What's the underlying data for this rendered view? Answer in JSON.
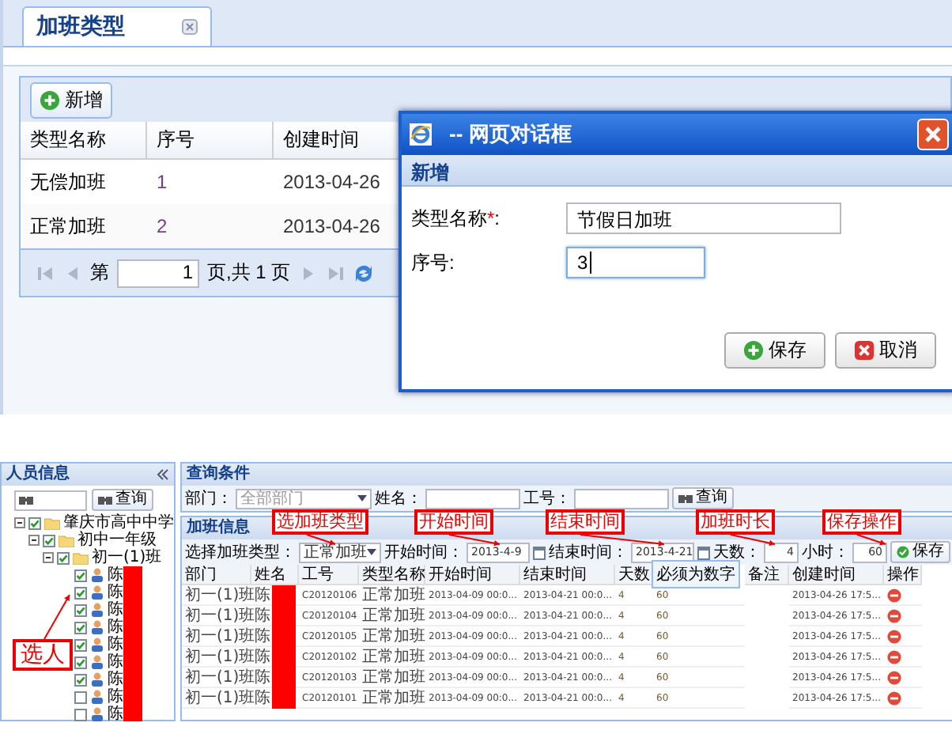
{
  "tab": {
    "label": "加班类型",
    "selected": true
  },
  "types_panel": {
    "add_button": "新增",
    "columns": [
      "类型名称",
      "序号",
      "创建时间"
    ],
    "rows": [
      {
        "cells": [
          "无偿加班",
          "1",
          "2013-04-26"
        ]
      },
      {
        "cells": [
          "正常加班",
          "2",
          "2013-04-26"
        ]
      }
    ],
    "pager": {
      "before": "第",
      "page": "1",
      "after": "页,共 1 页"
    }
  },
  "dialog": {
    "title": "-- 网页对话框",
    "header": "新增",
    "fields": [
      {
        "label": "类型名称",
        "mark": "*",
        "colon": ":",
        "value": "节假日加班",
        "focused": false
      },
      {
        "label": "序号:",
        "value": "3",
        "focused": true
      }
    ],
    "buttons": [
      {
        "kind": "save",
        "label": "保存"
      },
      {
        "kind": "cancel",
        "label": "取消"
      }
    ]
  },
  "staff_panel": {
    "title": "人员信息",
    "search_button": "查询",
    "tree": [
      {
        "kind": "folder",
        "label": "肇庆市高中中学",
        "checked": true,
        "expanded": true,
        "children": [
          {
            "kind": "folder",
            "label": "初中一年级",
            "checked": true,
            "expanded": true,
            "children": [
              {
                "kind": "folder",
                "label": "初一(1)班",
                "checked": true,
                "expanded": true,
                "children": [
                  {
                    "kind": "person",
                    "label": "陈",
                    "checked": true
                  },
                  {
                    "kind": "person",
                    "label": "陈",
                    "checked": true
                  },
                  {
                    "kind": "person",
                    "label": "陈",
                    "checked": true
                  },
                  {
                    "kind": "person",
                    "label": "陈",
                    "checked": true
                  },
                  {
                    "kind": "person",
                    "label": "陈",
                    "checked": true
                  },
                  {
                    "kind": "person",
                    "label": "陈",
                    "checked": true
                  },
                  {
                    "kind": "person",
                    "label": "陈",
                    "checked": true
                  },
                  {
                    "kind": "person",
                    "label": "陈",
                    "checked": false
                  },
                  {
                    "kind": "person",
                    "label": "陈",
                    "checked": false
                  }
                ]
              }
            ]
          }
        ]
      }
    ]
  },
  "query_panel": {
    "title": "查询条件",
    "search_button": "查询",
    "filters": [
      {
        "kind": "select",
        "label": "部门：",
        "placeholder": "全部部门"
      },
      {
        "kind": "text",
        "label": "姓名："
      },
      {
        "kind": "text",
        "label": "工号："
      }
    ]
  },
  "overtime_panel": {
    "title": "加班信息",
    "save_button": "保存",
    "tooltip": "必须为数字",
    "form": [
      {
        "kind": "select",
        "label": "选择加班类型：",
        "value": "正常加班"
      },
      {
        "kind": "date",
        "label": "开始时间：",
        "value": "2013-4-9"
      },
      {
        "kind": "date",
        "label": "结束时间：",
        "value": "2013-4-21"
      },
      {
        "kind": "number",
        "label": "天数：",
        "value": "4"
      },
      {
        "kind": "number",
        "label": "小时：",
        "value": "60"
      }
    ],
    "columns": [
      {
        "label": "部门"
      },
      {
        "label": "姓名"
      },
      {
        "label": "工号"
      },
      {
        "label": "类型名称"
      },
      {
        "label": "开始时间"
      },
      {
        "label": "结束时间"
      },
      {
        "label": "天数"
      },
      {},
      {
        "label": "备注"
      },
      {
        "label": "创建时间"
      },
      {
        "label": "操作"
      }
    ],
    "rows": [
      {
        "cells": [
          "初一(1)班",
          "陈",
          "C20120106",
          "正常加班",
          "2013-04-09 00:0...",
          "2013-04-21 00:0...",
          "4",
          "60",
          "",
          "2013-04-26 17:5..."
        ]
      },
      {
        "cells": [
          "初一(1)班",
          "陈",
          "C20120104",
          "正常加班",
          "2013-04-09 00:0...",
          "2013-04-21 00:0...",
          "4",
          "60",
          "",
          "2013-04-26 17:5..."
        ]
      },
      {
        "cells": [
          "初一(1)班",
          "陈",
          "C20120105",
          "正常加班",
          "2013-04-09 00:0...",
          "2013-04-21 00:0...",
          "4",
          "60",
          "",
          "2013-04-26 17:5..."
        ]
      },
      {
        "cells": [
          "初一(1)班",
          "陈",
          "C20120102",
          "正常加班",
          "2013-04-09 00:0...",
          "2013-04-21 00:0...",
          "4",
          "60",
          "",
          "2013-04-26 17:5..."
        ]
      },
      {
        "cells": [
          "初一(1)班",
          "陈",
          "C20120103",
          "正常加班",
          "2013-04-09 00:0...",
          "2013-04-21 00:0...",
          "4",
          "60",
          "",
          "2013-04-26 17:5..."
        ]
      },
      {
        "cells": [
          "初一(1)班",
          "陈",
          "C20120101",
          "正常加班",
          "2013-04-09 00:0...",
          "2013-04-21 00:0...",
          "4",
          "60",
          "",
          "2013-04-26 17:5..."
        ]
      }
    ]
  },
  "annotations": [
    {
      "label": "选人"
    },
    {
      "label": "选加班类型"
    },
    {
      "label": "开始时间"
    },
    {
      "label": "结束时间"
    },
    {
      "label": "加班时长"
    },
    {
      "label": "保存操作"
    }
  ]
}
